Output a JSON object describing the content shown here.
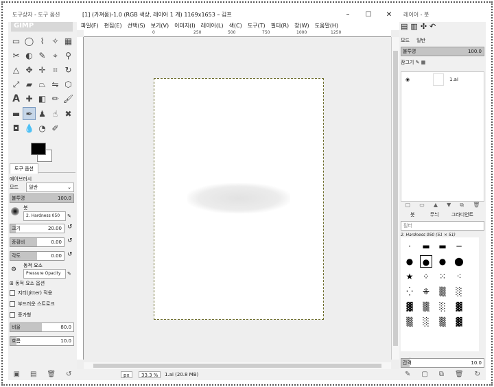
{
  "toolbox": {
    "title": "도구상자 - 도구 옵션",
    "tab_label": "도구 옵션",
    "tool_name": "에어브러시",
    "mode_label": "모드",
    "mode_value": "일반",
    "opacity_label": "불투명",
    "opacity_value": "100.0",
    "brush_label": "붓",
    "brush_value": "2. Hardness 050",
    "size_label": "크기",
    "size_value": "20.00",
    "ratio_label": "종횡비",
    "ratio_value": "0.00",
    "angle_label": "각도",
    "angle_value": "0.00",
    "dynamics_label": "동적 요소",
    "dynamics_value": "Pressure Opacity",
    "dynamics_options": "동적 요소 옵션",
    "jitter_label": "지터(Jitter) 적용",
    "smooth_label": "부드러운 스트로크",
    "incremental_label": "증가형",
    "rate_label": "비율",
    "rate_value": "80.0",
    "flow_label": "흐름",
    "flow_value": "10.0",
    "tool_icons": [
      "rect-select",
      "ellipse-select",
      "free-select",
      "fuzzy-select",
      "by-color-select",
      "scissors",
      "foreground-select",
      "paths",
      "color-picker",
      "zoom",
      "measure",
      "move",
      "align",
      "crop",
      "rotate",
      "scale",
      "shear",
      "perspective",
      "flip",
      "cage",
      "unified-transform",
      "text",
      "heal",
      "clone",
      "perspective-clone",
      "blur",
      "smudge",
      "dodge",
      "bucket-fill",
      "blend",
      "pencil",
      "paintbrush",
      "eraser",
      "airbrush",
      "ink",
      "mypaint",
      "warp",
      "color-balance"
    ]
  },
  "main": {
    "title": "[1] (가져옴)-1.0 (RGB 색상, 레이어 1 개) 1169x1653 – 김프",
    "menu": [
      "파일(F)",
      "편집(E)",
      "선택(S)",
      "보기(V)",
      "이미지(I)",
      "레이어(L)",
      "색(C)",
      "도구(T)",
      "필터(R)",
      "창(W)",
      "도움말(H)"
    ],
    "ruler_ticks": [
      "0",
      "250",
      "500",
      "750",
      "1000",
      "1250"
    ],
    "status_unit": "px",
    "status_zoom": "33.3 %",
    "status_file": "1.ai (20.8 MB)"
  },
  "layers": {
    "title": "레이어 - 붓",
    "mode_label": "모드",
    "mode_value": "일반",
    "opacity_label": "불투명",
    "opacity_value": "100.0",
    "lock_label": "잠그기",
    "layer_name": "1.ai",
    "brush_tabs": [
      "붓",
      "무늬",
      "그라디언트"
    ],
    "filter_placeholder": "필터",
    "brush_name": "2. Hardness 050 (51 × 51)",
    "preset_label": "Basic.",
    "spacing_label": "간격",
    "spacing_value": "10.0"
  }
}
